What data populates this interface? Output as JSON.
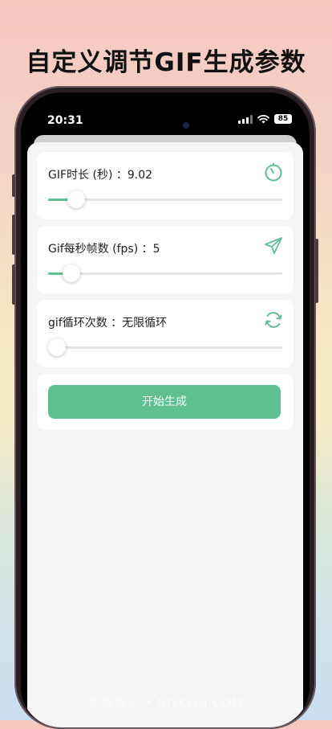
{
  "headline": "自定义调节GIF生成参数",
  "status_bar": {
    "time": "20:31",
    "battery": "85"
  },
  "settings": [
    {
      "label": "GIF时长 (秒) ：9.02",
      "icon": "timer-icon",
      "slider_fraction": 0.12
    },
    {
      "label": "Gif每秒帧数 (fps) ：5",
      "icon": "send-icon",
      "slider_fraction": 0.1
    },
    {
      "label": "gif循环次数 ：无限循环",
      "icon": "refresh-icon",
      "slider_fraction": 0.0
    }
  ],
  "start_button": "开始生成",
  "watermark": "乐享轻汇 • NJYCOH.COM",
  "colors": {
    "accent": "#5ec090",
    "track": "#e4e4e6"
  }
}
